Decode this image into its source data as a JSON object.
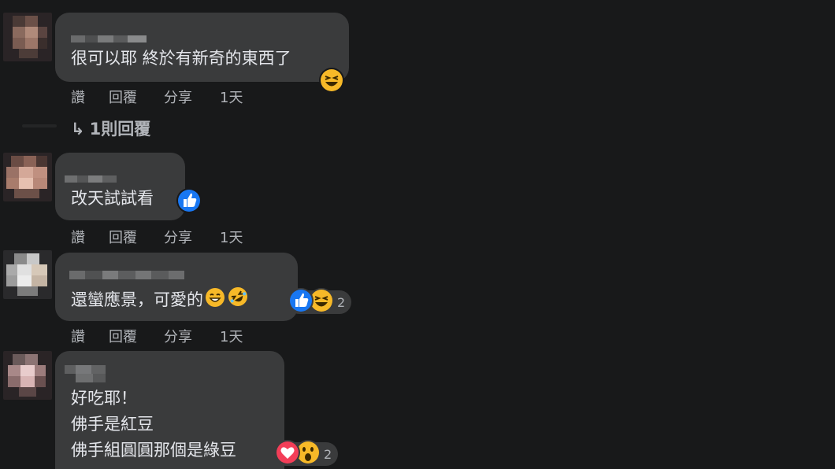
{
  "comments": [
    {
      "text_lines": [
        "很可以耶 終於有新奇的東西了"
      ],
      "actions": {
        "like": "讚",
        "reply": "回覆",
        "share": "分享",
        "time": "1天"
      },
      "reaction_icons": [
        "laughing-face-icon"
      ],
      "reaction_count": ""
    },
    {
      "text_lines": [
        "改天試試看"
      ],
      "actions": {
        "like": "讚",
        "reply": "回覆",
        "share": "分享",
        "time": "1天"
      },
      "reaction_icons": [
        "thumbs-up-icon"
      ],
      "reaction_count": ""
    },
    {
      "text_lines": [
        "還蠻應景，可愛的"
      ],
      "inline_emojis": [
        "grinning-face-icon",
        "rolling-laughing-face-icon"
      ],
      "actions": {
        "like": "讚",
        "reply": "回覆",
        "share": "分享",
        "time": "1天"
      },
      "reaction_icons": [
        "thumbs-up-icon",
        "laughing-face-icon"
      ],
      "reaction_count": "2"
    },
    {
      "text_lines": [
        "好吃耶！",
        "佛手是紅豆",
        "佛手組圓圓那個是綠豆"
      ],
      "reaction_icons": [
        "heart-icon",
        "wow-face-icon"
      ],
      "reaction_count": "2"
    }
  ],
  "replies_link": {
    "arrow": "↳",
    "label": "1則回覆"
  },
  "colors": {
    "background": "#18191a",
    "bubble": "#3a3b3c",
    "text": "#e4e6eb",
    "secondary_text": "#b0b3b8",
    "like_blue": "#1877f2",
    "love_red": "#f33e58",
    "haha_yellow": "#f7b928"
  }
}
